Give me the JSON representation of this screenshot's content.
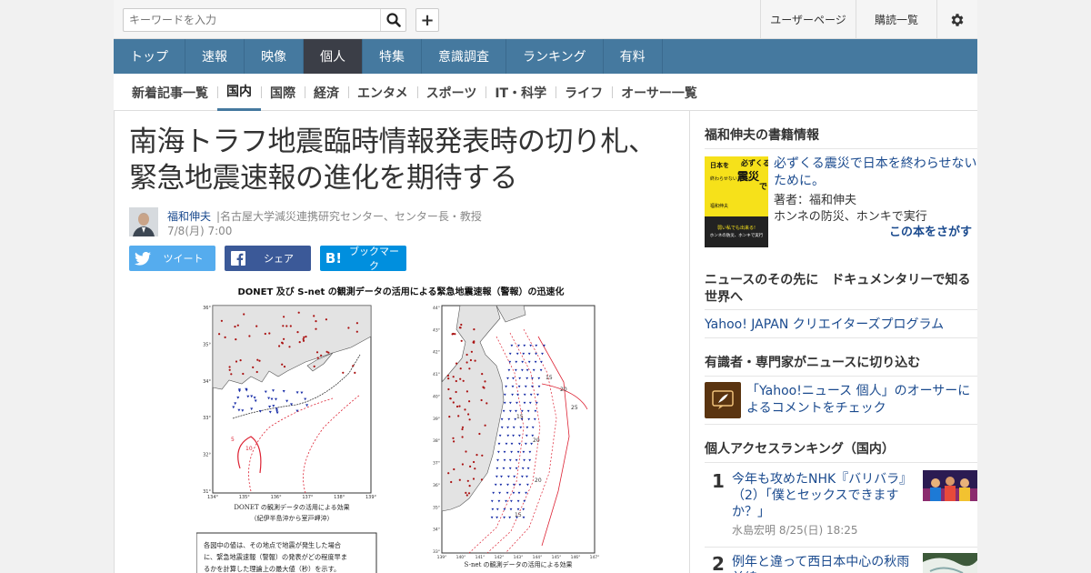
{
  "search": {
    "placeholder": "キーワードを入力"
  },
  "topbar": {
    "user_page": "ユーザーページ",
    "subscriptions": "購読一覧"
  },
  "global_nav": {
    "items": [
      {
        "label": "トップ"
      },
      {
        "label": "速報"
      },
      {
        "label": "映像"
      },
      {
        "label": "個人",
        "active": true
      },
      {
        "label": "特集"
      },
      {
        "label": "意識調査"
      },
      {
        "label": "ランキング"
      },
      {
        "label": "有料"
      }
    ]
  },
  "sub_nav": {
    "items": [
      {
        "label": "新着記事一覧"
      },
      {
        "label": "国内",
        "active": true
      },
      {
        "label": "国際"
      },
      {
        "label": "経済"
      },
      {
        "label": "エンタメ"
      },
      {
        "label": "スポーツ"
      },
      {
        "label": "IT・科学"
      },
      {
        "label": "ライフ"
      },
      {
        "label": "オーサー一覧"
      }
    ]
  },
  "article": {
    "title": "南海トラフ地震臨時情報発表時の切り札、緊急地震速報の進化を期待する",
    "author_name": "福和伸夫",
    "author_role": "|名古屋大学減災連携研究センター、センター長・教授",
    "date": "7/8(月) 7:00",
    "share": {
      "tweet": "ツイート",
      "share": "シェア",
      "bookmark": "ブックマーク"
    },
    "figure": {
      "title": "DONET 及び S-net の観測データの活用による緊急地震速報（警報）の迅速化",
      "left_caption_1": "DONET の観測データの活用による効果",
      "left_caption_2": "（紀伊半島沖から室戸岬沖）",
      "right_caption": "S-net の観測データの活用による効果",
      "note_1": "各図中の値は、その地点で地震が発生した場合",
      "note_2": "に、緊急地震速報（警報）の発表がどの程度早ま",
      "note_3": "るかを計算した理論上の最大値（秒）を示す。",
      "left_x_ticks": [
        "134°",
        "135°",
        "136°",
        "137°",
        "138°",
        "139°"
      ],
      "left_y_ticks": [
        "36°",
        "35°",
        "34°",
        "33°",
        "32°",
        "31°"
      ],
      "right_x_ticks": [
        "139°",
        "140°",
        "141°",
        "142°",
        "143°",
        "144°",
        "145°",
        "146°",
        "147°"
      ],
      "right_y_ticks": [
        "44°",
        "43°",
        "42°",
        "41°",
        "40°",
        "39°",
        "38°",
        "37°",
        "36°",
        "35°",
        "34°",
        "33°"
      ],
      "contour_labels": [
        "5",
        "10",
        "15",
        "20",
        "25",
        "15",
        "20",
        "20",
        "15"
      ]
    }
  },
  "sidebar": {
    "book_header": "福和伸夫の書籍情報",
    "book_title": "必ずくる震災で日本を終わらせないために。",
    "book_author": "著者：福和伸夫",
    "book_subtitle": "ホンネの防災、ホンキで実行",
    "book_find": "この本をさがす",
    "book_cover_text_1": "必ずくる",
    "book_cover_text_2": "震災",
    "book_cover_text_3": "で",
    "book_cover_text_4": "日本を",
    "book_cover_text_5": "終わらせないために。",
    "book_cover_author": "福和伸夫",
    "book_cover_band": "弱い私でも出来る!",
    "book_cover_band_2": "ホンネの防災、ホンキで実行",
    "doc_header": "ニュースのその先に　ドキュメンタリーで知る世界へ",
    "doc_link": "Yahoo! JAPAN クリエイターズプログラム",
    "experts_header": "有識者・専門家がニュースに切り込む",
    "experts_link": "「Yahoo!ニュース 個人」のオーサーによるコメントをチェック",
    "ranking_header": "個人アクセスランキング（国内）",
    "ranking": [
      {
        "rank": "1",
        "title": "今年も攻めたNHK『バリバラ』（2）「僕とセックスできますか？」",
        "author": "水島宏明",
        "date": "8/25(日) 18:25"
      },
      {
        "rank": "2",
        "title": "例年と違って西日本中心の秋雨前線",
        "author": "",
        "date": ""
      }
    ]
  },
  "colors": {
    "nav_bg": "#45799f",
    "nav_active": "#3b3e47",
    "link": "#1a4a8e",
    "twitter": "#55acee",
    "facebook": "#3b5998",
    "hatena": "#008fde"
  }
}
